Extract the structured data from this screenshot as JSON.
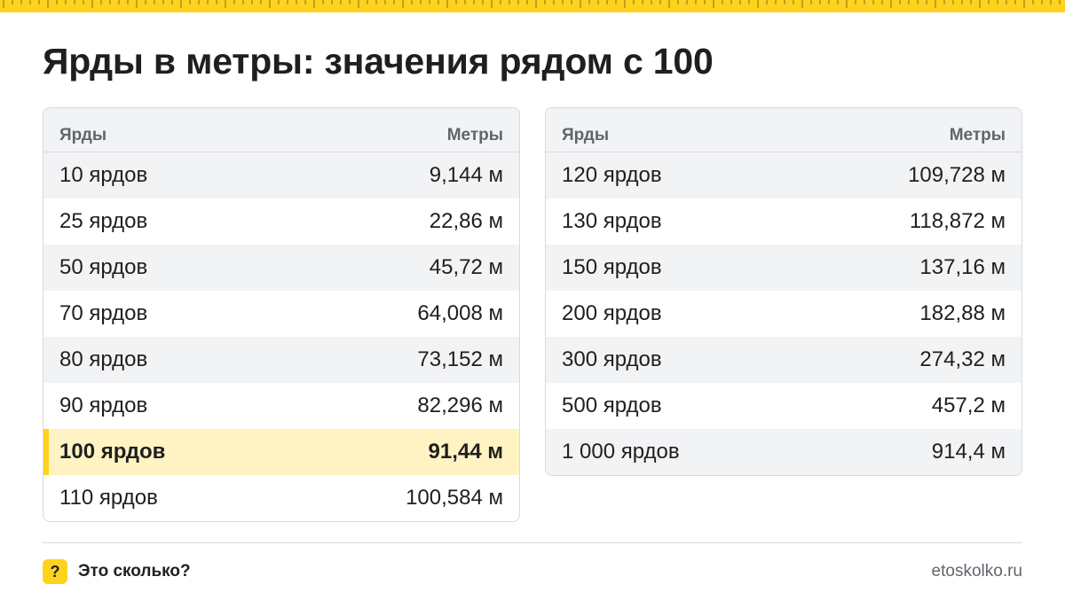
{
  "title": "Ярды в метры: значения рядом с 100",
  "colors": {
    "accent": "#FFD21F",
    "highlight_bg": "#FFF3C4",
    "header_bg": "#F2F3F5",
    "muted_text": "#60656D"
  },
  "tables": [
    {
      "headers": {
        "left": "Ярды",
        "right": "Метры"
      },
      "rows": [
        {
          "yards": "10 ярдов",
          "meters": "9,144 м"
        },
        {
          "yards": "25 ярдов",
          "meters": "22,86 м"
        },
        {
          "yards": "50 ярдов",
          "meters": "45,72 м"
        },
        {
          "yards": "70 ярдов",
          "meters": "64,008 м"
        },
        {
          "yards": "80 ярдов",
          "meters": "73,152 м"
        },
        {
          "yards": "90 ярдов",
          "meters": "82,296 м"
        },
        {
          "yards": "100 ярдов",
          "meters": "91,44 м"
        },
        {
          "yards": "110 ярдов",
          "meters": "100,584 м"
        }
      ]
    },
    {
      "headers": {
        "left": "Ярды",
        "right": "Метры"
      },
      "rows": [
        {
          "yards": "120 ярдов",
          "meters": "109,728 м"
        },
        {
          "yards": "130 ярдов",
          "meters": "118,872 м"
        },
        {
          "yards": "150 ярдов",
          "meters": "137,16 м"
        },
        {
          "yards": "200 ярдов",
          "meters": "182,88 м"
        },
        {
          "yards": "300 ярдов",
          "meters": "274,32 м"
        },
        {
          "yards": "500 ярдов",
          "meters": "457,2 м"
        },
        {
          "yards": "1 000 ярдов",
          "meters": "914,4 м"
        }
      ]
    }
  ],
  "footer": {
    "icon": "question-icon",
    "icon_glyph": "?",
    "brand": "Это сколько?",
    "site": "etoskolko.ru"
  }
}
